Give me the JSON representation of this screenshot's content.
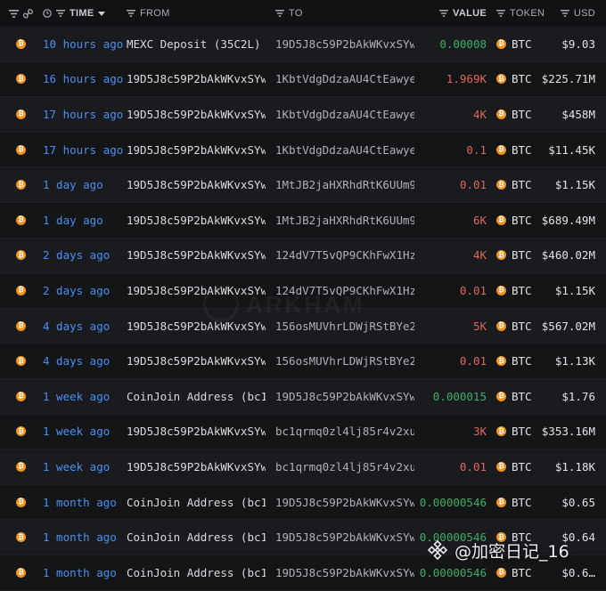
{
  "header": {
    "time": "TIME",
    "from": "FROM",
    "to": "TO",
    "value": "VALUE",
    "token": "TOKEN",
    "usd": "USD"
  },
  "colors": {
    "positive": "#3fae63",
    "negative": "#e0675b",
    "time_link": "#4a8ff0",
    "btc": "#f7931a"
  },
  "rows": [
    {
      "time": "10 hours ago",
      "from": "MEXC Deposit (35C2L)",
      "to": "19D5J8c59P2bAkWKvxSYw…",
      "value": "0.00008",
      "dir": "pos",
      "token": "BTC",
      "usd": "$9.03"
    },
    {
      "time": "16 hours ago",
      "from": "19D5J8c59P2bAkWKvxSYw…",
      "to": "1KbtVdgDdzaAU4CtEawye…",
      "value": "1.969K",
      "dir": "neg",
      "token": "BTC",
      "usd": "$225.71M"
    },
    {
      "time": "17 hours ago",
      "from": "19D5J8c59P2bAkWKvxSYw…",
      "to": "1KbtVdgDdzaAU4CtEawye…",
      "value": "4K",
      "dir": "neg",
      "token": "BTC",
      "usd": "$458M"
    },
    {
      "time": "17 hours ago",
      "from": "19D5J8c59P2bAkWKvxSYw…",
      "to": "1KbtVdgDdzaAU4CtEawye…",
      "value": "0.1",
      "dir": "neg",
      "token": "BTC",
      "usd": "$11.45K"
    },
    {
      "time": "1 day ago",
      "from": "19D5J8c59P2bAkWKvxSYw…",
      "to": "1MtJB2jaHXRhdRtK6UUm9…",
      "value": "0.01",
      "dir": "neg",
      "token": "BTC",
      "usd": "$1.15K"
    },
    {
      "time": "1 day ago",
      "from": "19D5J8c59P2bAkWKvxSYw…",
      "to": "1MtJB2jaHXRhdRtK6UUm9…",
      "value": "6K",
      "dir": "neg",
      "token": "BTC",
      "usd": "$689.49M"
    },
    {
      "time": "2 days ago",
      "from": "19D5J8c59P2bAkWKvxSYw…",
      "to": "124dV7T5vQP9CKhFwX1Hz…",
      "value": "4K",
      "dir": "neg",
      "token": "BTC",
      "usd": "$460.02M"
    },
    {
      "time": "2 days ago",
      "from": "19D5J8c59P2bAkWKvxSYw…",
      "to": "124dV7T5vQP9CKhFwX1Hz…",
      "value": "0.01",
      "dir": "neg",
      "token": "BTC",
      "usd": "$1.15K"
    },
    {
      "time": "4 days ago",
      "from": "19D5J8c59P2bAkWKvxSYw…",
      "to": "156osMUVhrLDWjRStBYe2…",
      "value": "5K",
      "dir": "neg",
      "token": "BTC",
      "usd": "$567.02M"
    },
    {
      "time": "4 days ago",
      "from": "19D5J8c59P2bAkWKvxSYw…",
      "to": "156osMUVhrLDWjRStBYe2…",
      "value": "0.01",
      "dir": "neg",
      "token": "BTC",
      "usd": "$1.13K"
    },
    {
      "time": "1 week ago",
      "from": "CoinJoin Address (bc1…",
      "to": "19D5J8c59P2bAkWKvxSYw…",
      "value": "0.000015",
      "dir": "pos",
      "token": "BTC",
      "usd": "$1.76"
    },
    {
      "time": "1 week ago",
      "from": "19D5J8c59P2bAkWKvxSYw…",
      "to": "bc1qrmq0zl4lj85r4v2xu…",
      "value": "3K",
      "dir": "neg",
      "token": "BTC",
      "usd": "$353.16M"
    },
    {
      "time": "1 week ago",
      "from": "19D5J8c59P2bAkWKvxSYw…",
      "to": "bc1qrmq0zl4lj85r4v2xu…",
      "value": "0.01",
      "dir": "neg",
      "token": "BTC",
      "usd": "$1.18K"
    },
    {
      "time": "1 month ago",
      "from": "CoinJoin Address (bc1…",
      "to": "19D5J8c59P2bAkWKvxSYw…",
      "value": "0.00000546",
      "dir": "pos",
      "token": "BTC",
      "usd": "$0.65"
    },
    {
      "time": "1 month ago",
      "from": "CoinJoin Address (bc1…",
      "to": "19D5J8c59P2bAkWKvxSYw…",
      "value": "0.00000546",
      "dir": "pos",
      "token": "BTC",
      "usd": "$0.64"
    },
    {
      "time": "1 month ago",
      "from": "CoinJoin Address (bc1…",
      "to": "19D5J8c59P2bAkWKvxSYw…",
      "value": "0.00000546",
      "dir": "pos",
      "token": "BTC",
      "usd": "$0.6…"
    }
  ],
  "background_watermark": "ARKHAM",
  "watermark": {
    "text": "@加密日记_16"
  }
}
